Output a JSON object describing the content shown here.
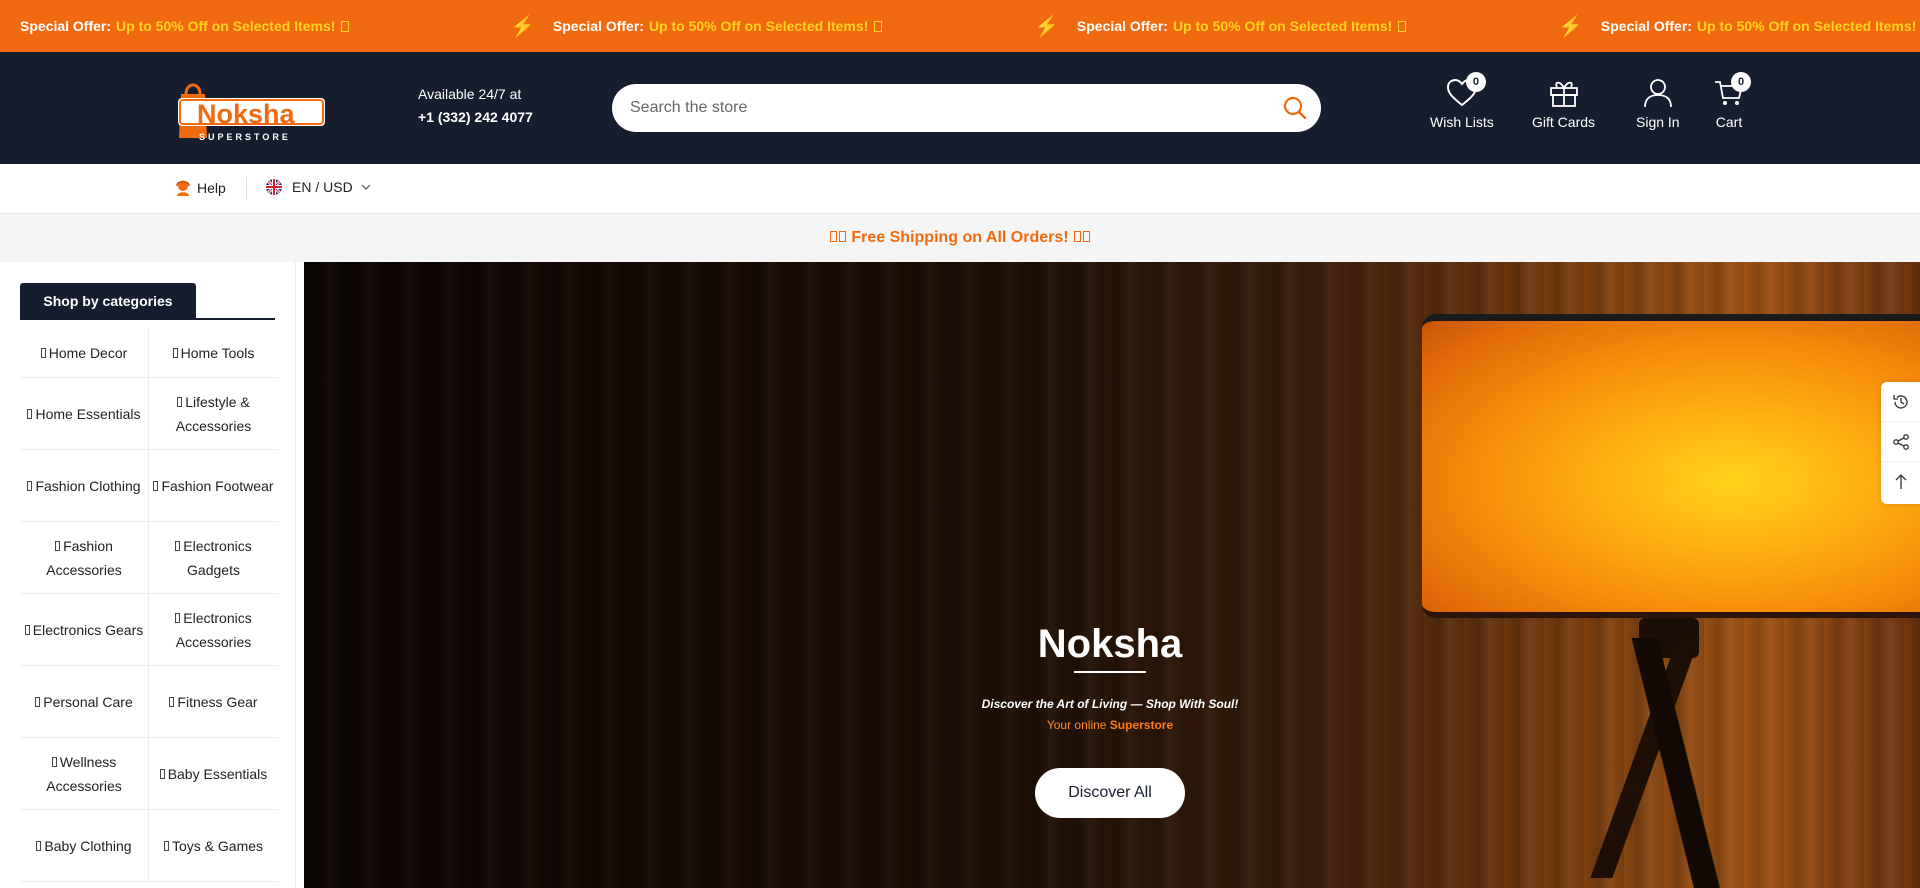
{
  "announcement": {
    "items": [
      {
        "label": "Special Offer:",
        "text": "Up to 50% Off on Selected Items!"
      },
      {
        "label": "Special Offer:",
        "text": "Up to 50% Off on Selected Items!"
      },
      {
        "label": "Special Offer:",
        "text": "Up to 50% Off on Selected Items!"
      },
      {
        "label": "Special Offer:",
        "text": "Up to 50% Off on Selected Items!"
      }
    ],
    "bolt_icon": "lightning-icon",
    "bg_color": "#f26a10",
    "highlight_color": "#ffd21f"
  },
  "header": {
    "logo_text": "Noksha",
    "logo_sub": "SUPERSTORE",
    "contact_line1": "Available 24/7 at",
    "contact_phone": "+1 (332) 242 4077",
    "search_placeholder": "Search the store",
    "wishlist_label": "Wish Lists",
    "wishlist_count": "0",
    "giftcards_label": "Gift Cards",
    "signin_label": "Sign In",
    "cart_label": "Cart",
    "cart_count": "0",
    "bg_color": "#151d2e"
  },
  "utility": {
    "help_label": "Help",
    "lang_label": "EN / USD"
  },
  "shipping": {
    "text": "Free Shipping on All Orders!"
  },
  "sidebar": {
    "title": "Shop by categories",
    "categories": [
      "Home Decor",
      "Home Tools",
      "Home Essentials",
      "Lifestyle & Accessories",
      "Fashion Clothing",
      "Fashion Footwear",
      "Fashion Accessories",
      "Electronics Gadgets",
      "Electronics Gears",
      "Electronics Accessories",
      "Personal Care",
      "Fitness Gear",
      "Wellness Accessories",
      "Baby Essentials",
      "Baby Clothing",
      "Toys & Games"
    ]
  },
  "hero": {
    "title": "Noksha",
    "tagline": "Discover the Art of Living — Shop With Soul!",
    "sub_prefix": "Your online",
    "sub_highlight": "Superstore",
    "button_label": "Discover All"
  },
  "float_tools": [
    "history-icon",
    "share-icon",
    "arrow-up-icon"
  ]
}
